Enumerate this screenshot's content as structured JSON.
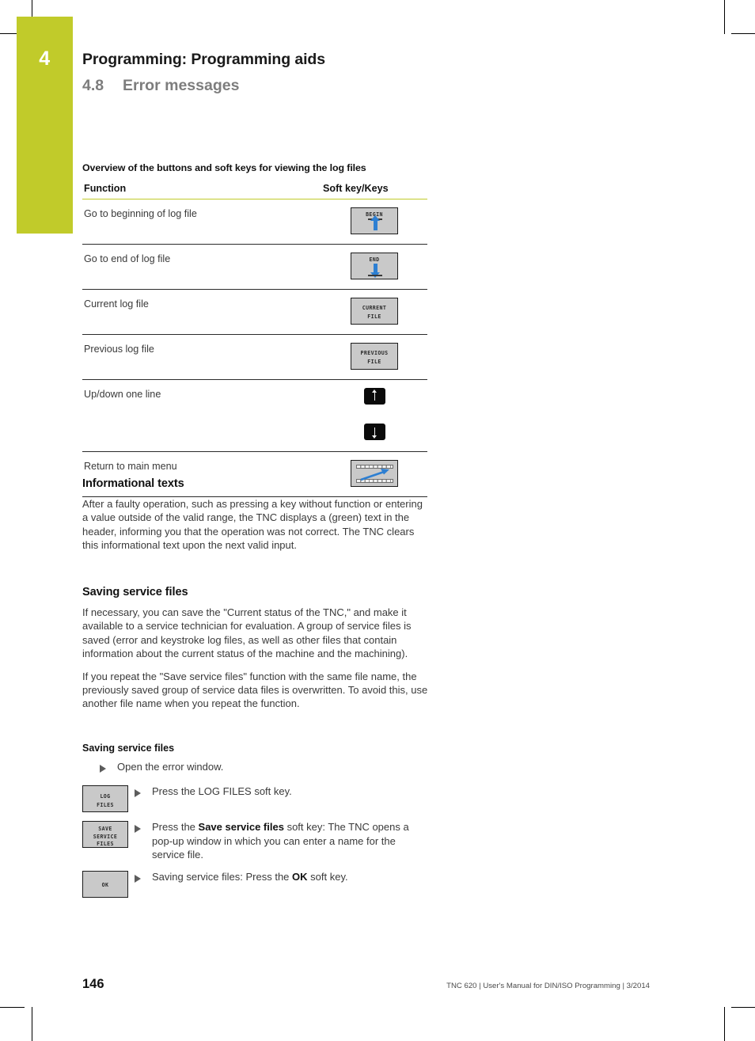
{
  "chapter": {
    "number": "4",
    "title": "Programming: Programming aids",
    "section_number": "4.8",
    "section_title": "Error messages"
  },
  "table": {
    "caption": "Overview of the buttons and soft keys for viewing the log files",
    "columns": [
      "Function",
      "Soft key/Keys"
    ],
    "rows": [
      {
        "function": "Go to beginning of log file",
        "key_label": "BEGIN",
        "key_type": "softkey-begin"
      },
      {
        "function": "Go to end of log file",
        "key_label": "END",
        "key_type": "softkey-end"
      },
      {
        "function": "Current log file",
        "key_label": "CURRENT\nFILE",
        "key_type": "softkey-text2"
      },
      {
        "function": "Previous log file",
        "key_label": "PREVIOUS\nFILE",
        "key_type": "softkey-text2"
      },
      {
        "function": "Up/down one line",
        "key_label": "",
        "key_type": "hardkey-up-down"
      },
      {
        "function": "Return to main menu",
        "key_label": "",
        "key_type": "softkey-return"
      }
    ]
  },
  "informational": {
    "heading": "Informational texts",
    "paragraph": "After a faulty operation, such as pressing a key without function or entering a value outside of the valid range, the TNC displays a (green) text in the header, informing you that the operation was not correct. The TNC clears this informational text upon the next valid input."
  },
  "saving": {
    "heading": "Saving service files",
    "paragraph1": "If necessary, you can save the \"Current status of the TNC,\" and make it available to a service technician for evaluation. A group of service files is saved (error and keystroke log files, as well as other files that contain information about the current status of the machine and the machining).",
    "paragraph2": "If you repeat the \"Save service files\" function with the same file name, the previously saved group of service data files is overwritten. To avoid this, use another file name when you repeat the function.",
    "procedure_heading": "Saving service files",
    "steps": [
      {
        "key_label": "",
        "text_plain": "Open the error window."
      },
      {
        "key_label": "LOG\nFILES",
        "text_plain": "Press the LOG FILES soft key."
      },
      {
        "key_label": "SAVE\nSERVICE\nFILES",
        "text_pre": "Press the ",
        "text_bold": "Save service files",
        "text_post": " soft key: The TNC opens a pop-up window in which you can enter a name for the service file."
      },
      {
        "key_label": "OK",
        "text_pre": "Saving service files: Press the ",
        "text_bold": "OK",
        "text_post": " soft key."
      }
    ]
  },
  "footer": {
    "page_number": "146",
    "note": "TNC 620 | User's Manual for DIN/ISO Programming | 3/2014"
  },
  "colors": {
    "accent": "#c1cb2a",
    "arrow_blue": "#2d7fd2",
    "softkey_gray": "#c9c9c9",
    "hardkey_black": "#0b0b0b"
  }
}
